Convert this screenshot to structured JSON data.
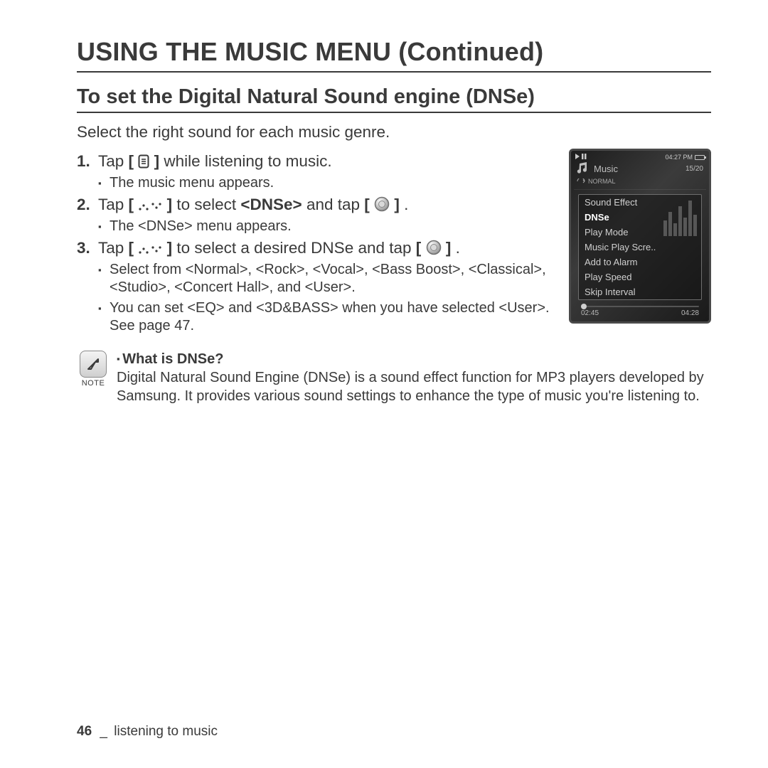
{
  "heading1": "USING THE MUSIC MENU (Continued)",
  "heading2": "To set the Digital Natural Sound engine (DNSe)",
  "lede": "Select the right sound for each music genre.",
  "steps": {
    "s1": {
      "num": "1.",
      "pre": "Tap ",
      "post": " while listening to music.",
      "sub1": "The music menu appears."
    },
    "s2": {
      "num": "2.",
      "pre": "Tap ",
      "mid": " to select ",
      "bold": "<DNSe>",
      "mid2": " and tap ",
      "post": ".",
      "sub1": "The <DNSe> menu appears."
    },
    "s3": {
      "num": "3.",
      "pre": "Tap ",
      "mid": " to select a desired DNSe and tap ",
      "post": ".",
      "sub1": "Select from <Normal>, <Rock>, <Vocal>, <Bass Boost>, <Classical>, <Studio>, <Concert Hall>, and <User>.",
      "sub2": "You can set <EQ> and <3D&BASS> when you have selected <User>. See page 47."
    }
  },
  "note": {
    "label": "NOTE",
    "title": "What is DNSe?",
    "body": "Digital Natural Sound Engine (DNSe) is a sound effect function for MP3 players developed by Samsung. It provides various sound settings to enhance the type of music you're listening to."
  },
  "footer": {
    "page": "46",
    "section": "listening to music"
  },
  "device": {
    "time": "04:27 PM",
    "title": "Music",
    "counter": "15/20",
    "mode": "NORMAL",
    "menu": [
      "Sound Effect",
      "DNSe",
      "Play Mode",
      "Music Play Scre..",
      "Add to Alarm",
      "Play Speed",
      "Skip Interval"
    ],
    "selected_index": 1,
    "elapsed": "02:45",
    "total": "04:28"
  },
  "icons": {
    "menu": "menu-icon",
    "updown": "up-down-icon",
    "select": "select-icon",
    "note": "note-icon"
  },
  "brackets": {
    "open": "[",
    "close": "]"
  }
}
